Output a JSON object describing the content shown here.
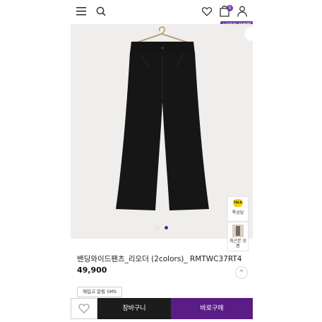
{
  "header": {
    "icons": [
      "menu-icon",
      "search-icon",
      "heart-icon",
      "bag-icon",
      "user-icon"
    ],
    "cart_count": "0",
    "promo_label": "10만원 웰컴팩"
  },
  "gallery": {
    "current": 2,
    "total": 2
  },
  "floating": {
    "talk_bubble": "TALK",
    "talk_label": "톡상담",
    "recent_label": "최근본 상품",
    "top_arrow": "^"
  },
  "product": {
    "name": "밴딩와이드팬츠_리오더 (2colors)_ RMTWC37RT4",
    "price": "49,900"
  },
  "actions": {
    "sms_label": "재입고 알림 SMS",
    "cart_label": "장바구니",
    "buy_label": "바로구매"
  },
  "colors": {
    "accent": "#5a1d85",
    "badge": "#6b3fa0",
    "dark": "#1c1c1c"
  }
}
